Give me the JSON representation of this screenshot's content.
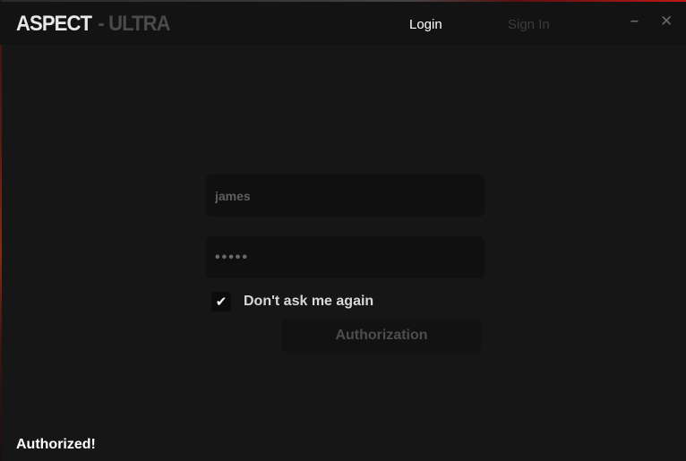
{
  "app": {
    "brand_main": "ASPECT",
    "brand_separator": "-",
    "brand_sub": "ULTRA"
  },
  "tabs": {
    "login": "Login",
    "signin": "Sign In"
  },
  "window_controls": {
    "minimize": "–",
    "close": "✕"
  },
  "form": {
    "username_value": "james",
    "password_value": "•••••",
    "remember_checked": true,
    "remember_label": "Don't ask me again",
    "checkmark": "✔",
    "submit_label": "Authorization"
  },
  "status": {
    "message": "Authorized!"
  },
  "colors": {
    "background": "#161616",
    "titlebar": "#131313",
    "field": "#101010",
    "accent_red": "#c01818",
    "active_tab": "#ffffff",
    "inactive_tab": "#3c3c3c"
  }
}
